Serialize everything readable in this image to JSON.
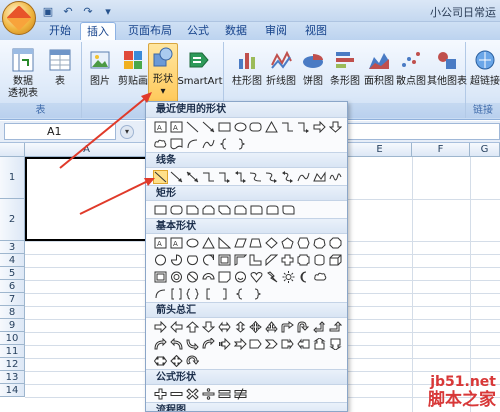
{
  "title": "小公司日常运",
  "tabs": [
    "开始",
    "插入",
    "页面布局",
    "公式",
    "数据",
    "审阅",
    "视图"
  ],
  "active_tab": "插入",
  "ribbon": {
    "pivot_label": "数据\n透视表",
    "table_label": "表",
    "group_table": "表",
    "picture": "图片",
    "clipart": "剪贴画",
    "shapes": "形状",
    "smartart": "SmartArt",
    "column": "柱形图",
    "line": "折线图",
    "pie": "饼图",
    "bar": "条形图",
    "area": "面积图",
    "scatter": "散点图",
    "other": "其他图表",
    "hyperlink": "超链接",
    "group_links": "链接"
  },
  "namebox": "A1",
  "columns": [
    "A",
    "E",
    "F",
    "G"
  ],
  "rows": [
    "1",
    "2",
    "3",
    "4",
    "5",
    "6",
    "7",
    "8",
    "9",
    "10",
    "11",
    "12",
    "13",
    "14"
  ],
  "dropdown": {
    "recent": "最近使用的形状",
    "lines": "线条",
    "rect": "矩形",
    "basic": "基本形状",
    "arrows": "箭头总汇",
    "formula": "公式形状",
    "flowchart": "流程图"
  },
  "watermark1": "jb51.net",
  "watermark2": "脚本之家"
}
